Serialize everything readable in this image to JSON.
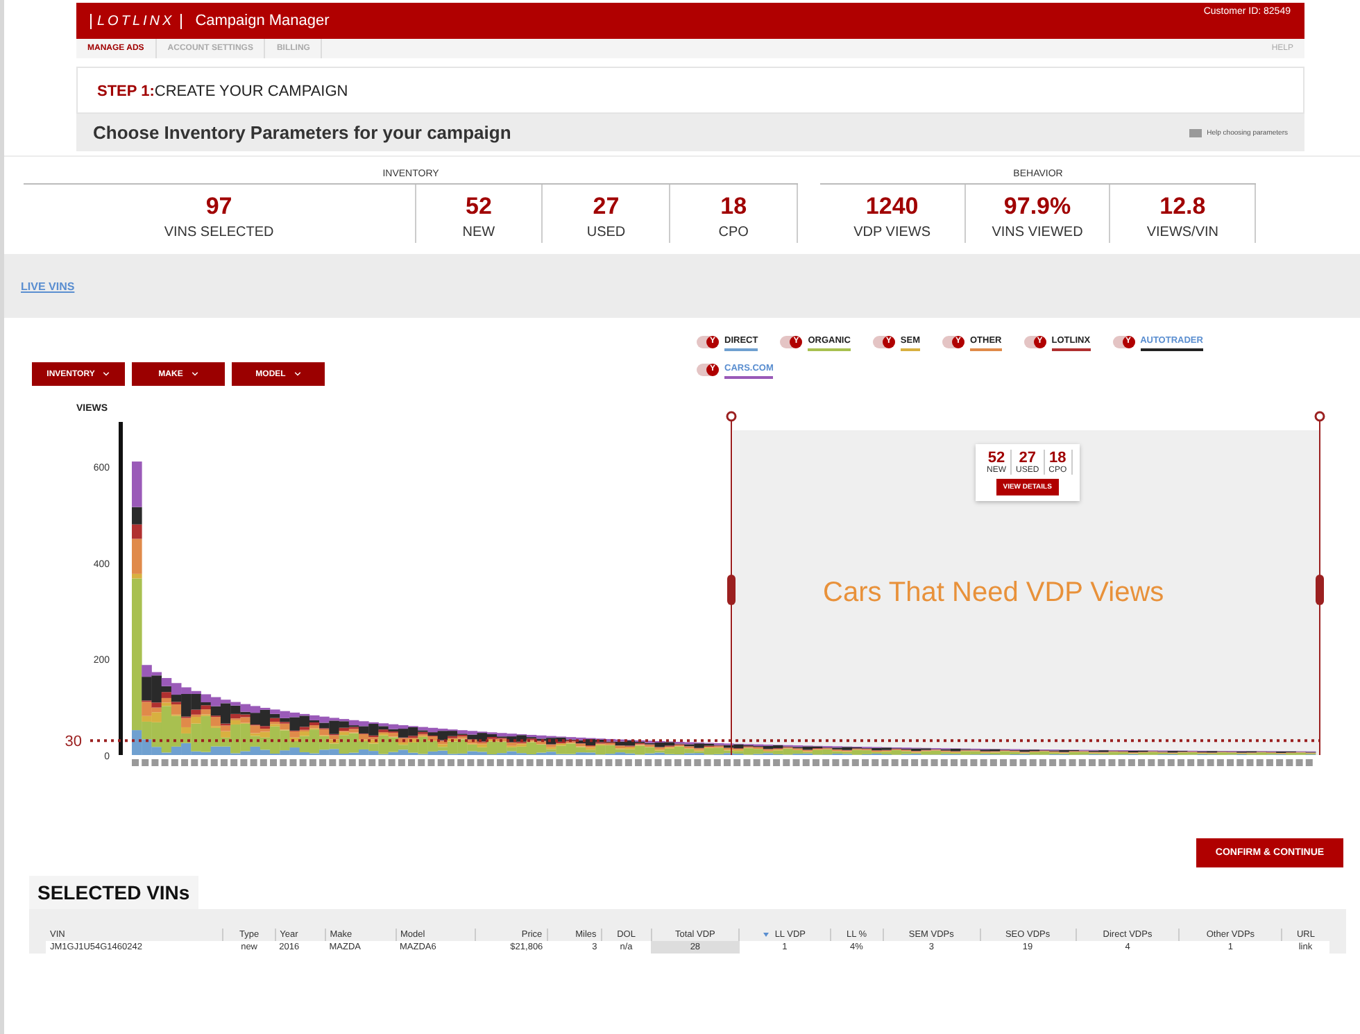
{
  "header": {
    "logo": "LOTLINX",
    "title": "Campaign Manager",
    "customer_id": "Customer ID: 82549"
  },
  "nav": {
    "tabs": [
      {
        "label": "MANAGE ADS",
        "selected": true
      },
      {
        "label": "ACCOUNT SETTINGS",
        "selected": false
      },
      {
        "label": "BILLING",
        "selected": false
      }
    ],
    "help": "HELP"
  },
  "step": {
    "number": "STEP 1:",
    "text": "CREATE YOUR CAMPAIGN"
  },
  "page_title": "Choose Inventory Parameters for your campaign",
  "help_link": "Help choosing parameters",
  "stat_groups": [
    {
      "title": "INVENTORY",
      "stats": [
        {
          "value": "97",
          "label": "VINS SELECTED"
        },
        {
          "value": "52",
          "label": "NEW"
        },
        {
          "value": "27",
          "label": "USED"
        },
        {
          "value": "18",
          "label": "CPO"
        }
      ]
    },
    {
      "title": "BEHAVIOR",
      "stats": [
        {
          "value": "1240",
          "label": "VDP VIEWS"
        },
        {
          "value": "97.9%",
          "label": "VINS VIEWED"
        },
        {
          "value": "12.8",
          "label": "VIEWS/VIN"
        }
      ]
    }
  ],
  "live_vins": "LIVE VINS",
  "filters": [
    "INVENTORY",
    "MAKE",
    "MODEL"
  ],
  "legend": [
    {
      "label": "DIRECT",
      "on": true,
      "toggle_glyph": "Y",
      "highlighted": false,
      "color": "#6fa0d0"
    },
    {
      "label": "ORGANIC",
      "on": true,
      "toggle_glyph": "Y",
      "highlighted": false,
      "color": "#a8c050"
    },
    {
      "label": "SEM",
      "on": true,
      "toggle_glyph": "Y",
      "highlighted": false,
      "color": "#d8b040"
    },
    {
      "label": "OTHER",
      "on": true,
      "toggle_glyph": "Y",
      "highlighted": false,
      "color": "#e08a4a"
    },
    {
      "label": "LOTLINX",
      "on": true,
      "toggle_glyph": "Y",
      "highlighted": false,
      "color": "#b03030"
    },
    {
      "label": "AUTOTRADER",
      "on": true,
      "toggle_glyph": "Y",
      "highlighted": true,
      "color": "#222222"
    },
    {
      "label": "CARS.COM",
      "on": true,
      "toggle_glyph": "Y",
      "highlighted": true,
      "color": "#9a5ab8"
    }
  ],
  "chart": {
    "axis_title": "VIEWS",
    "y_ticks": [
      "600",
      "400",
      "200",
      "0"
    ],
    "threshold_label": "30",
    "region_label": "Cars That Need VDP Views",
    "popup": {
      "stats": [
        {
          "value": "52",
          "label": "NEW"
        },
        {
          "value": "27",
          "label": "USED"
        },
        {
          "value": "18",
          "label": "CPO"
        }
      ],
      "button": "VIEW DETAILS"
    }
  },
  "confirm_button": "CONFIRM & CONTINUE",
  "table": {
    "title": "SELECTED VINs",
    "columns": [
      {
        "label": "VIN",
        "sorted": false
      },
      {
        "label": "Type",
        "sorted": false
      },
      {
        "label": "Year",
        "sorted": false
      },
      {
        "label": "Make",
        "sorted": false
      },
      {
        "label": "Model",
        "sorted": false
      },
      {
        "label": "Price",
        "sorted": false
      },
      {
        "label": "Miles",
        "sorted": false
      },
      {
        "label": "DOL",
        "sorted": false
      },
      {
        "label": "Total VDP",
        "sorted": false
      },
      {
        "label": "LL VDP",
        "sorted": true
      },
      {
        "label": "LL %",
        "sorted": false
      },
      {
        "label": "SEM VDPs",
        "sorted": false
      },
      {
        "label": "SEO VDPs",
        "sorted": false
      },
      {
        "label": "Direct VDPs",
        "sorted": false
      },
      {
        "label": "Other VDPs",
        "sorted": false
      },
      {
        "label": "URL",
        "sorted": false
      }
    ],
    "rows": [
      [
        "JM1GJ1U54G1460242",
        "new",
        "2016",
        "MAZDA",
        "MAZDA6",
        "$21,806",
        "3",
        "n/a",
        "28",
        "1",
        "4%",
        "3",
        "19",
        "4",
        "1",
        "link"
      ]
    ]
  }
}
